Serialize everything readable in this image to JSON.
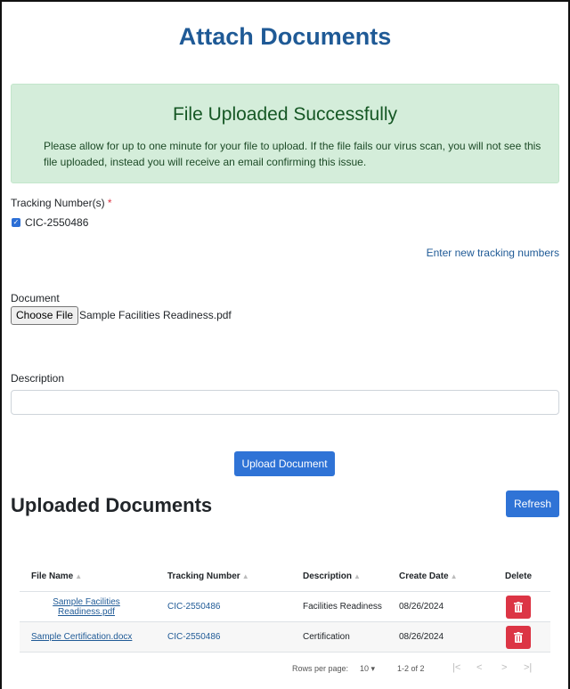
{
  "header": {
    "title": "Attach Documents"
  },
  "alert": {
    "title": "File Uploaded Successfully",
    "message": "Please allow for up to one minute for your file to upload. If the file fails our virus scan, you will not see this file uploaded, instead you will receive an email confirming this issue."
  },
  "tracking": {
    "label": "Tracking Number(s)",
    "required_mark": "*",
    "checked_value": "CIC-2550486",
    "new_link": "Enter new tracking numbers"
  },
  "document": {
    "label": "Document",
    "choose_button": "Choose File",
    "selected_file": "Sample Facilities Readiness.pdf"
  },
  "description": {
    "label": "Description",
    "value": ""
  },
  "upload_button": "Upload Document",
  "uploaded": {
    "title": "Uploaded Documents",
    "refresh_button": "Refresh",
    "columns": [
      "File Name",
      "Tracking Number",
      "Description",
      "Create Date",
      "Delete"
    ],
    "rows": [
      {
        "file_line1": "Sample Facilities",
        "file_line2": "Readiness.pdf",
        "tracking": "CIC-2550486",
        "description": "Facilities Readiness",
        "date": "08/26/2024"
      },
      {
        "file": "Sample Certification.docx",
        "tracking": "CIC-2550486",
        "description": "Certification",
        "date": "08/26/2024"
      }
    ]
  },
  "pagination": {
    "rows_per_page_label": "Rows per page:",
    "rows_per_page_value": "10",
    "range": "1-2 of 2"
  },
  "icons": {
    "checkbox": "checkmark-icon",
    "sort": "sort-arrow-icon",
    "delete": "trash-icon",
    "dropdown": "caret-down-icon",
    "first": "first-page-icon",
    "prev": "prev-page-icon",
    "next": "next-page-icon",
    "last": "last-page-icon"
  },
  "colors": {
    "primary": "#2f73d6",
    "title": "#1f5a96",
    "success_bg": "#d4edda",
    "success_text": "#155724",
    "danger": "#dc3545"
  }
}
